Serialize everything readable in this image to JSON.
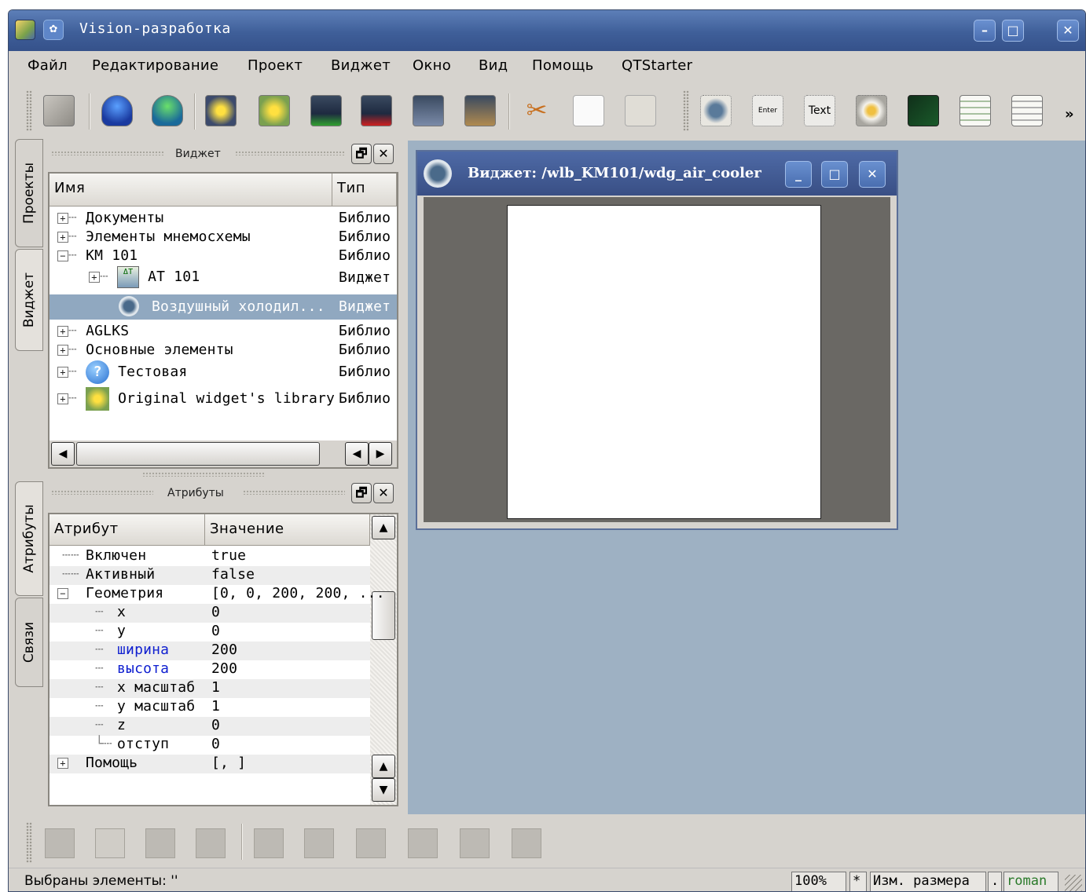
{
  "window": {
    "title": "Vision-разработка",
    "sys_icon": "gear-icon"
  },
  "menu": [
    "Файл",
    "Редактирование",
    "Проект",
    "Виджет",
    "Окно",
    "Вид",
    "Помощь",
    "QTStarter"
  ],
  "toolbar": {
    "overflow": "»"
  },
  "vtabs": {
    "projects": "Проекты",
    "widget": "Виджет",
    "attributes": "Атрибуты",
    "links": "Связи"
  },
  "widget_dock": {
    "title": "Виджет",
    "columns": [
      "Имя",
      "Тип"
    ],
    "rows": [
      {
        "name": "Документы",
        "type": "Библио"
      },
      {
        "name": "Элементы мнемосхемы",
        "type": "Библио"
      },
      {
        "name": "KM 101",
        "type": "Библио"
      },
      {
        "name": "AT 101",
        "type": "Виджет"
      },
      {
        "name": "Воздушный холодил...",
        "type": "Виджет"
      },
      {
        "name": "AGLKS",
        "type": "Библио"
      },
      {
        "name": "Основные элементы",
        "type": "Библио"
      },
      {
        "name": "Тестовая",
        "type": "Библио"
      },
      {
        "name": "Original widget's library",
        "type": "Библио"
      }
    ]
  },
  "attr_dock": {
    "title": "Атрибуты",
    "columns": [
      "Атрибут",
      "Значение"
    ],
    "rows": [
      {
        "name": "Включен",
        "value": "true"
      },
      {
        "name": "Активный",
        "value": "false"
      },
      {
        "name": "Геометрия",
        "value": "[0, 0, 200, 200, ..."
      },
      {
        "name": "x",
        "value": "0"
      },
      {
        "name": "y",
        "value": "0"
      },
      {
        "name": "ширина",
        "value": "200"
      },
      {
        "name": "высота",
        "value": "200"
      },
      {
        "name": "x масштаб",
        "value": "1"
      },
      {
        "name": "y масштаб",
        "value": "1"
      },
      {
        "name": "z",
        "value": "0"
      },
      {
        "name": "отступ",
        "value": "0"
      },
      {
        "name": "Помощь",
        "value": "[, ]"
      }
    ]
  },
  "subwindow": {
    "title": "Виджет: /wlb_KM101/wdg_air_cooler"
  },
  "status": {
    "text": "Выбраны элементы: ''",
    "zoom": "100%",
    "modified": "*",
    "mode": "Изм. размера",
    "dot": ".",
    "user": "roman"
  }
}
